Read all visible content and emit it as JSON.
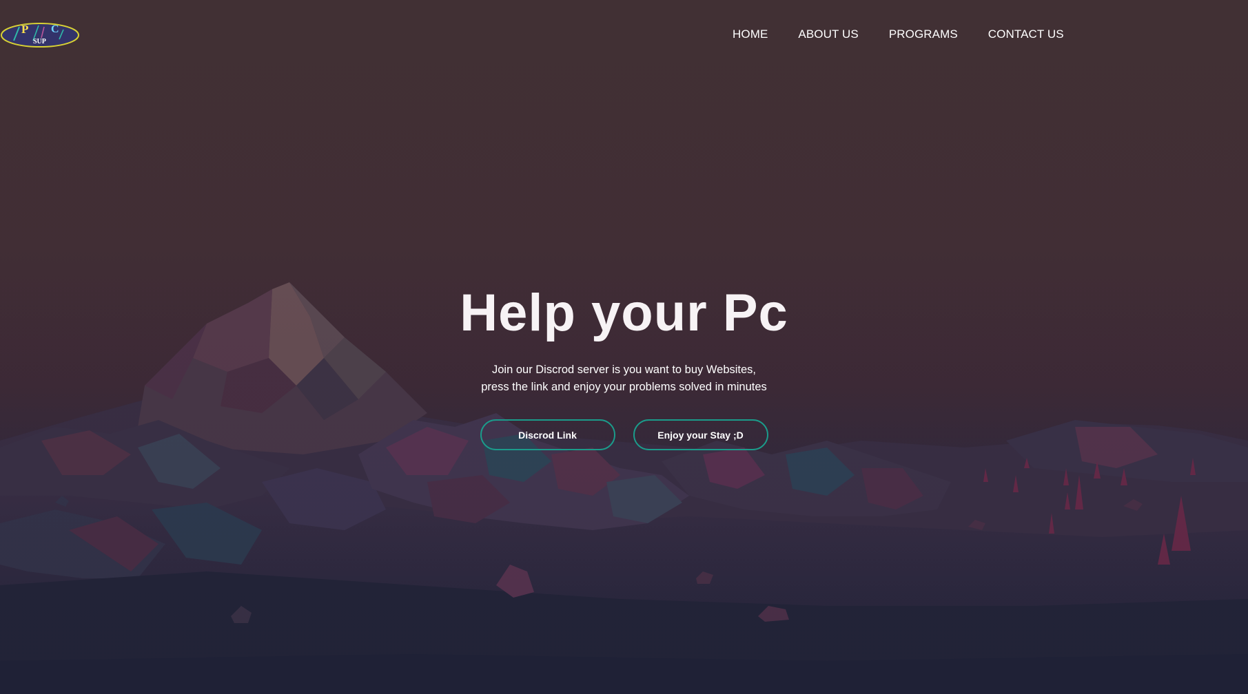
{
  "logo": {
    "letters": [
      "P",
      "C"
    ],
    "subtext": "SUP"
  },
  "nav": {
    "items": [
      {
        "label": "HOME"
      },
      {
        "label": "ABOUT US"
      },
      {
        "label": "PROGRAMS"
      },
      {
        "label": "CONTACT US"
      }
    ]
  },
  "hero": {
    "title": "Help your Pc",
    "description_line1": "Join our Discrod server is you want to buy Websites,",
    "description_line2": "press the link and enjoy your problems solved in minutes",
    "buttons": [
      {
        "label": "Discrod Link"
      },
      {
        "label": "Enjoy your Stay ;D"
      }
    ]
  },
  "colors": {
    "button_border": "#1b9c8b",
    "logo_ring": "#d8d234",
    "logo_fill": "#33336a",
    "text": "#ffffff"
  }
}
